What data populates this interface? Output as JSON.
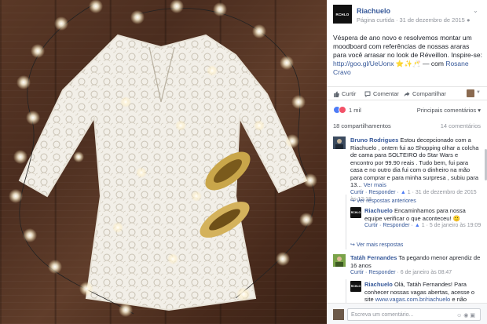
{
  "post": {
    "page_name": "Riachuelo",
    "logo_text": "RCHLO",
    "page_type": "Página curtida",
    "date": "31 de dezembro de 2015",
    "text_main": "Véspera de ano novo e resolvemos montar um moodboard com referências de nossas araras para você arrasar no look de Réveillon. Inspire-se:",
    "text_link": "http://goo.gl/UeUonx",
    "text_emoji": "⭐✨🥂",
    "text_with": "— com",
    "text_tagged": "Rosane Cravo"
  },
  "actions": {
    "like": "Curtir",
    "comment": "Comentar",
    "share": "Compartilhar"
  },
  "reactions": {
    "count": "1 mil",
    "sort": "Principais comentários ▾"
  },
  "stats": {
    "shares": "18 compartilhamentos",
    "comments": "14 comentários"
  },
  "comments": [
    {
      "name": "Bruno Rodrigues",
      "text": "Estou decepcionado com a Riachuelo , ontem fui ao Shopping olhar a colcha de cama para SOLTEIRO do Star Wars e encontro por 99.90 reais . Tudo bem, fui para casa e no outro dia fui com o dinheiro na mão para comprar e para minha surpresa , subiu para 13...",
      "more": "Ver mais",
      "reply": "Curtir · Responder ·",
      "likes": "1",
      "time": "· 31 de dezembro de 2015 às 12:18",
      "prev_replies": "Ver respostas anteriores",
      "reply_comment": {
        "name": "Riachuelo",
        "logo_text": "RCHLO",
        "text": "Encaminhamos para nossa equipe verificar o que aconteceu! 🙂",
        "reply": "Curtir · Responder ·",
        "likes": "1",
        "time": "· 5 de janeiro às 19:09"
      },
      "more_replies": "Ver mais respostas"
    },
    {
      "name": "Tatáh Fernandes",
      "text": "Ta pegando menor aprendiz de 16 anos",
      "reply": "Curtir · Responder",
      "time": "· 6 de janeiro às 08:47",
      "reply_comment": {
        "name": "Riachuelo",
        "logo_text": "RCHLO",
        "text": "Olá, Tatáh Fernandes! Para conhecer nossas vagas abertas, acesse o site",
        "link": "www.vagas.com.br/riachuelo",
        "tail": "e não"
      }
    }
  ],
  "composer": {
    "placeholder": "Escreva um comentário..."
  }
}
